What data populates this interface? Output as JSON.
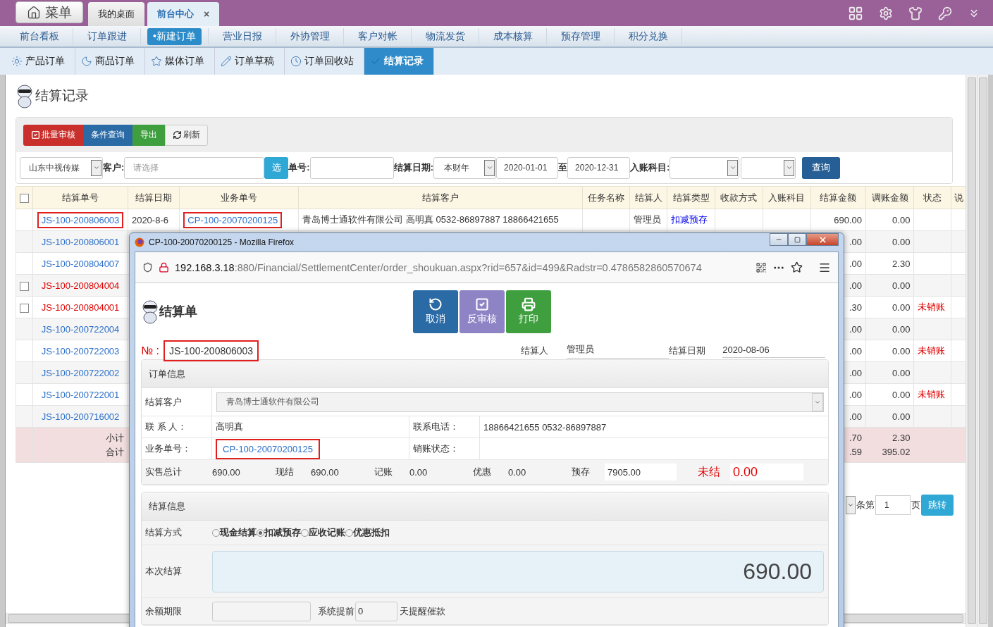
{
  "top_bar": {
    "menu_button": "菜单",
    "tabs": [
      {
        "label": "我的桌面",
        "selected": false
      },
      {
        "label": "前台中心",
        "selected": true,
        "close": "×"
      }
    ]
  },
  "nav": [
    {
      "label": "前台看板",
      "selected": false
    },
    {
      "label": "订单跟进",
      "selected": false
    },
    {
      "label": "•新建订单",
      "selected": true
    },
    {
      "label": "营业日报",
      "selected": false
    },
    {
      "label": "外协管理",
      "selected": false
    },
    {
      "label": "客户对帐",
      "selected": false
    },
    {
      "label": "物流发货",
      "selected": false
    },
    {
      "label": "成本核算",
      "selected": false
    },
    {
      "label": "预存管理",
      "selected": false
    },
    {
      "label": "积分兑换",
      "selected": false
    }
  ],
  "sub_tabs": [
    {
      "label": "产品订单",
      "selected": false
    },
    {
      "label": "商品订单",
      "selected": false
    },
    {
      "label": "媒体订单",
      "selected": false
    },
    {
      "label": "订单草稿",
      "selected": false
    },
    {
      "label": "订单回收站",
      "selected": false
    },
    {
      "label": "结算记录",
      "selected": true
    }
  ],
  "page_title": "结算记录",
  "toolbar": [
    {
      "label": "批量审核",
      "kind": "danger"
    },
    {
      "label": "条件查询",
      "kind": "primary"
    },
    {
      "label": "导出",
      "kind": "success"
    },
    {
      "label": "刷新",
      "kind": "default"
    }
  ],
  "filters": {
    "company": "山东中视传媒",
    "customer_label": "客户:",
    "customer_placeholder": "请选择",
    "choose_button": "选",
    "order_no_label": "单号:",
    "date_label": "结算日期:",
    "period": "本财年",
    "date_from": "2020-01-01",
    "to_label": "至",
    "date_to": "2020-12-31",
    "account_label": "入账科目:",
    "query_button": "查询"
  },
  "table": {
    "header_checked": false,
    "columns": [
      "结算单号",
      "结算日期",
      "业务单号",
      "结算客户",
      "任务名称",
      "结算人",
      "结算类型",
      "收款方式",
      "入账科目",
      "结算金额",
      "调账金额",
      "状态",
      "说"
    ],
    "rows": [
      {
        "number": "JS-100-200806003",
        "color": "#2a6fc9",
        "kind": "plain",
        "highlighted": true,
        "date": "2020-8-6",
        "biz_no": "CP-100-20070200125",
        "customer": "青岛博士通软件有限公司 高明真 0532-86897887 18866421655",
        "handler": "管理员",
        "type": "扣减预存",
        "amount": "690.00",
        "adjust": "0.00"
      },
      {
        "number": "JS-100-200806001",
        "color": "#2a6fc9",
        "kind": "plain",
        "highlighted": false,
        "amount": ".00",
        "adjust": "0.00"
      },
      {
        "number": "JS-100-200804007",
        "color": "#2a6fc9",
        "kind": "plain",
        "highlighted": false,
        "amount": ".00",
        "adjust": "2.30"
      },
      {
        "number": "JS-100-200804004",
        "color": "#e00000",
        "kind": "selectable",
        "checked": false,
        "highlighted": false,
        "amount": ".00",
        "adjust": "0.00"
      },
      {
        "number": "JS-100-200804001",
        "color": "#e00000",
        "kind": "selectable",
        "checked": false,
        "highlighted": false,
        "amount": ".30",
        "adjust": "0.00",
        "status": "未销账"
      },
      {
        "number": "JS-100-200722004",
        "color": "#2a6fc9",
        "kind": "plain",
        "highlighted": false,
        "amount": ".00",
        "adjust": "0.00"
      },
      {
        "number": "JS-100-200722003",
        "color": "#2a6fc9",
        "kind": "plain",
        "highlighted": false,
        "amount": ".00",
        "adjust": "0.00",
        "status": "未销账"
      },
      {
        "number": "JS-100-200722002",
        "color": "#2a6fc9",
        "kind": "plain",
        "highlighted": false,
        "amount": ".00",
        "adjust": "0.00"
      },
      {
        "number": "JS-100-200722001",
        "color": "#2a6fc9",
        "kind": "plain",
        "highlighted": false,
        "amount": ".00",
        "adjust": "0.00",
        "status": "未销账"
      },
      {
        "number": "JS-100-200716002",
        "color": "#2a6fc9",
        "kind": "plain",
        "highlighted": false,
        "amount": ".00",
        "adjust": "0.00"
      }
    ],
    "totals": {
      "labels": [
        "小计",
        "合计"
      ],
      "amounts": [
        ".70",
        ".59"
      ],
      "adjusts": [
        "2.30",
        "395.02"
      ]
    }
  },
  "pagination": {
    "rows_suffix": "条第",
    "page": "1",
    "page_suffix": "页",
    "jump_button": "跳转"
  },
  "popup": {
    "window_title": "CP-100-20070200125 - Mozilla Firefox",
    "url_host": "192.168.3.18",
    "url_rest": ":880/Financial/SettlementCenter/order_shoukuan.aspx?rid=657&id=499&Radstr=0.4786582860570674",
    "title": "结算单",
    "actions": [
      {
        "label": "取消",
        "kind": "primary"
      },
      {
        "label": "反审核",
        "kind": "purple"
      },
      {
        "label": "打印",
        "kind": "success"
      }
    ],
    "no_label": "№ :",
    "no": "JS-100-200806003",
    "no_highlighted": true,
    "handler_label": "结算人",
    "handler": "管理员",
    "date_label": "结算日期",
    "date": "2020-08-06",
    "order_info": {
      "title": "订单信息",
      "customer_label": "结算客户",
      "customer": "青岛博士通软件有限公司",
      "contact_label": "联 系 人：",
      "contact": "高明真",
      "phone_label": "联系电话：",
      "phone": "18866421655 0532-86897887",
      "biz_label": "业务单号：",
      "biz_no": "CP-100-20070200125",
      "biz_highlighted": true,
      "writeoff_label": "销账状态：",
      "totals": [
        {
          "label": "实售总计",
          "value": "690.00",
          "kind": "plain"
        },
        {
          "label": "现结",
          "value": "690.00",
          "kind": "plain"
        },
        {
          "label": "记账",
          "value": "0.00",
          "kind": "plain"
        },
        {
          "label": "优惠",
          "value": "0.00",
          "kind": "plain"
        },
        {
          "label": "预存",
          "value": "7905.00",
          "kind": "field"
        },
        {
          "label": "未结",
          "value": "0.00",
          "kind": "alert"
        }
      ]
    },
    "settle_info": {
      "title": "结算信息",
      "method_label": "结算方式",
      "methods": [
        {
          "label": "现金结算",
          "selected": false
        },
        {
          "label": "扣减预存",
          "selected": true
        },
        {
          "label": "应收记账",
          "selected": false
        },
        {
          "label": "优惠抵扣",
          "selected": false
        }
      ],
      "amount_label": "本次结算",
      "amount": "690.00",
      "limit_label": "余额期限",
      "remind_prefix": "系统提前",
      "remind_days": "0",
      "remind_suffix": "天提醒催款"
    }
  }
}
